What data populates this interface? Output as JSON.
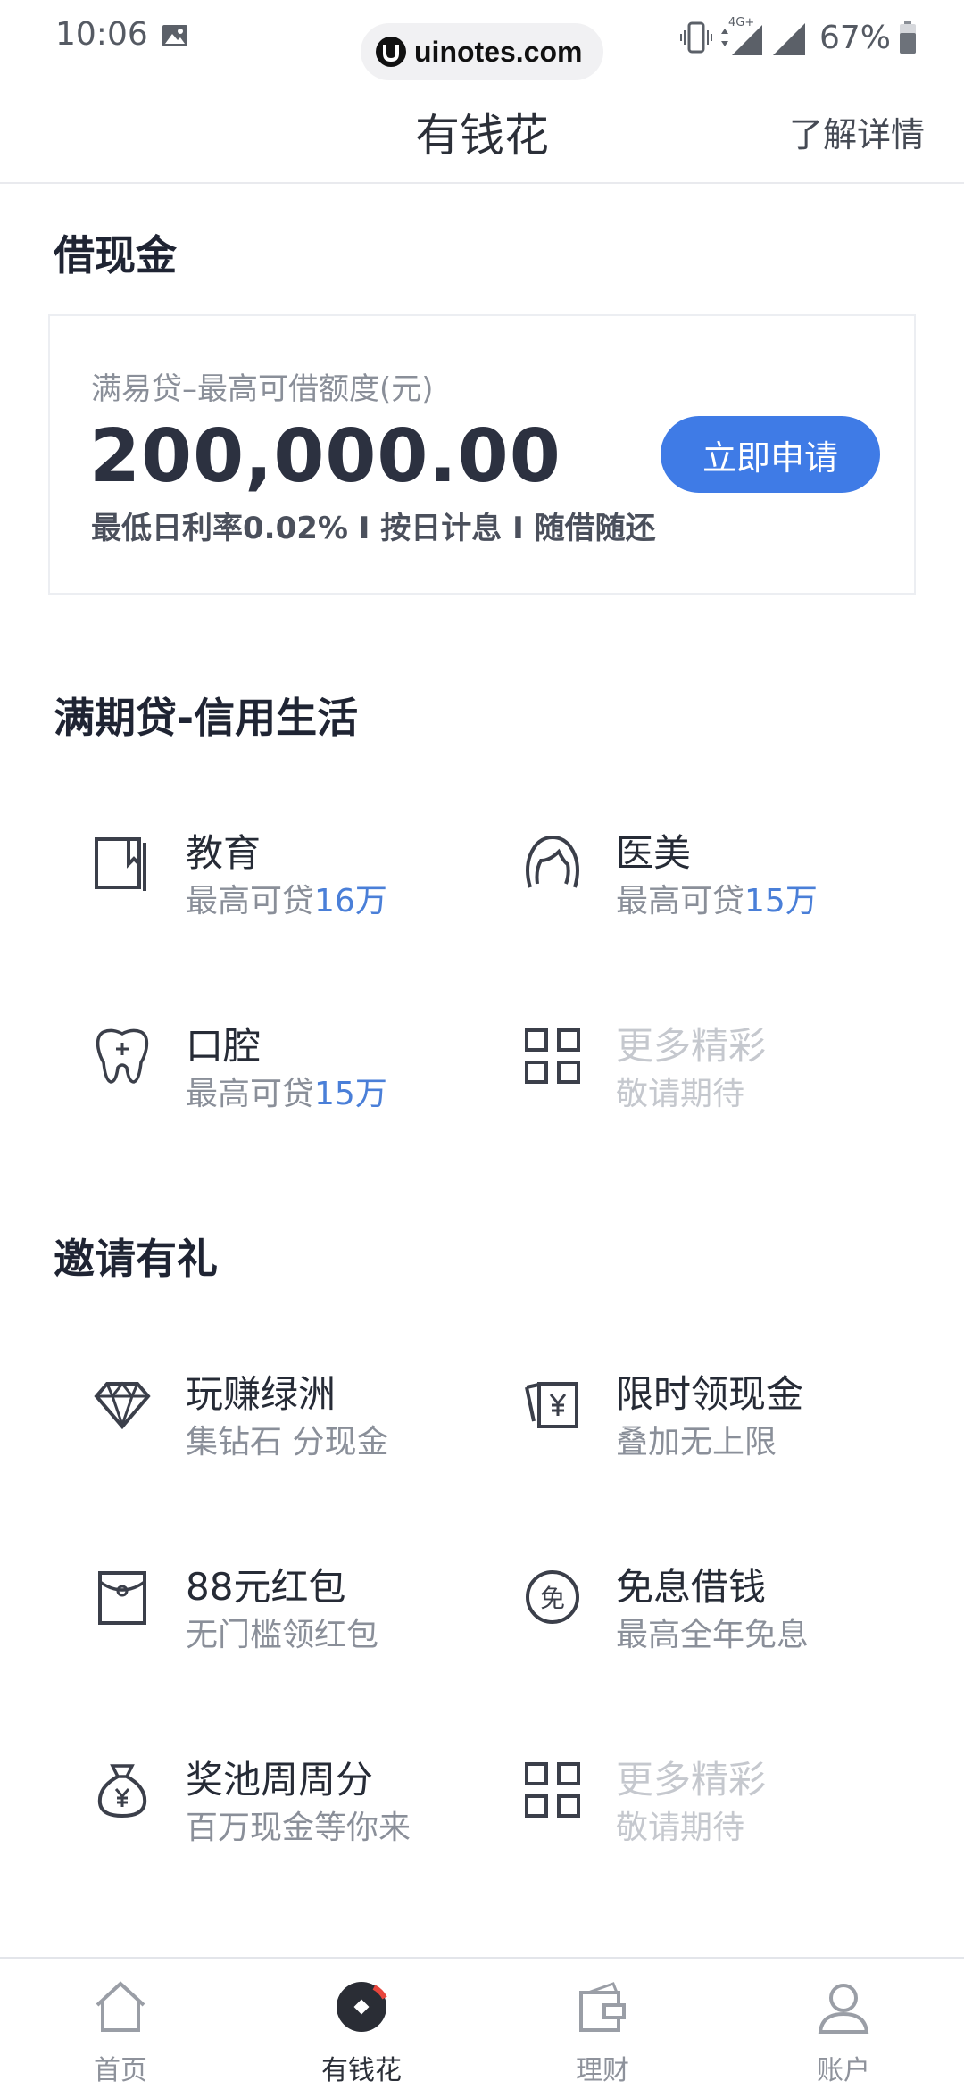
{
  "status_bar": {
    "time": "10:06",
    "watermark": "uinotes.com",
    "network": "4G+",
    "battery": "67%"
  },
  "header": {
    "title": "有钱花",
    "detail_link": "了解详情"
  },
  "cash_section": {
    "title": "借现金",
    "card": {
      "subtitle": "满易贷–最高可借额度(元)",
      "amount": "200,000.00",
      "features": "最低日利率0.02% I 按日计息 I 随借随还",
      "apply_label": "立即申请"
    }
  },
  "installment_section": {
    "title": "满期贷-信用生活",
    "items": [
      {
        "title": "教育",
        "sub_prefix": "最高可贷",
        "sub_highlight": "16万",
        "icon": "book-icon"
      },
      {
        "title": "医美",
        "sub_prefix": "最高可贷",
        "sub_highlight": "15万",
        "icon": "face-icon"
      },
      {
        "title": "口腔",
        "sub_prefix": "最高可贷",
        "sub_highlight": "15万",
        "icon": "tooth-icon"
      },
      {
        "title": "更多精彩",
        "sub": "敬请期待",
        "icon": "grid-icon"
      }
    ]
  },
  "invite_section": {
    "title": "邀请有礼",
    "items": [
      {
        "title": "玩赚绿洲",
        "sub": "集钻石 分现金",
        "icon": "diamond-icon"
      },
      {
        "title": "限时领现金",
        "sub": "叠加无上限",
        "icon": "cash-card-icon"
      },
      {
        "title": "88元红包",
        "sub": "无门槛领红包",
        "icon": "red-envelope-icon"
      },
      {
        "title": "免息借钱",
        "sub": "最高全年免息",
        "icon": "interest-free-icon"
      },
      {
        "title": "奖池周周分",
        "sub": "百万现金等你来",
        "icon": "money-bag-icon"
      },
      {
        "title": "更多精彩",
        "sub": "敬请期待",
        "icon": "grid-icon"
      }
    ]
  },
  "bottom_nav": {
    "items": [
      {
        "label": "首页",
        "icon": "home-icon"
      },
      {
        "label": "有钱花",
        "icon": "youqianhua-icon",
        "active": true
      },
      {
        "label": "理财",
        "icon": "wallet-icon"
      },
      {
        "label": "账户",
        "icon": "user-icon"
      }
    ]
  },
  "colors": {
    "accent": "#3f7be6",
    "highlight_text": "#4a7fd8",
    "title_text": "#1f2433",
    "muted_text": "#c5c8ce"
  }
}
